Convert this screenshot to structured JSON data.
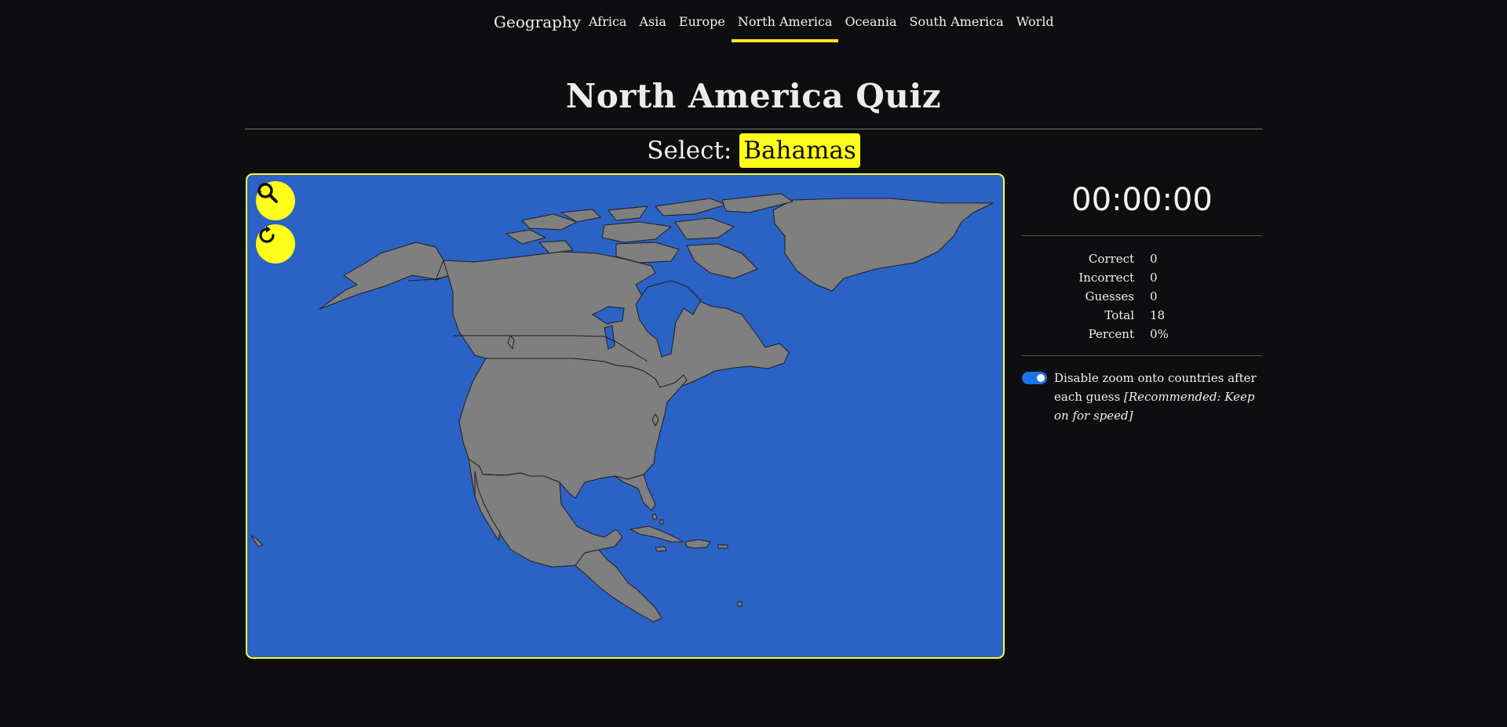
{
  "nav": {
    "brand": "Geography",
    "links": [
      "Africa",
      "Asia",
      "Europe",
      "North America",
      "Oceania",
      "South America",
      "World"
    ],
    "active": "North America"
  },
  "quiz": {
    "title": "North America Quiz",
    "select_prefix": "Select:",
    "target": "Bahamas"
  },
  "map": {
    "zoom_button_icon": "zoom-search-icon",
    "reset_button_icon": "refresh-icon",
    "ocean_color": "#2b62c6",
    "land_color": "#7f7f7f",
    "border_color": "#ffff33"
  },
  "timer": "00:00:00",
  "stats": [
    {
      "label": "Correct",
      "value": "0"
    },
    {
      "label": "Incorrect",
      "value": "0"
    },
    {
      "label": "Guesses",
      "value": "0"
    },
    {
      "label": "Total",
      "value": "18"
    },
    {
      "label": "Percent",
      "value": "0%"
    }
  ],
  "settings": {
    "disable_zoom_enabled": true,
    "disable_zoom_label": "Disable zoom onto countries after each guess",
    "disable_zoom_hint": "[Recommended: Keep on for speed]"
  },
  "colors": {
    "accent": "#ffff1a",
    "background": "#0e0e10",
    "toggle": "#1a73e8"
  }
}
